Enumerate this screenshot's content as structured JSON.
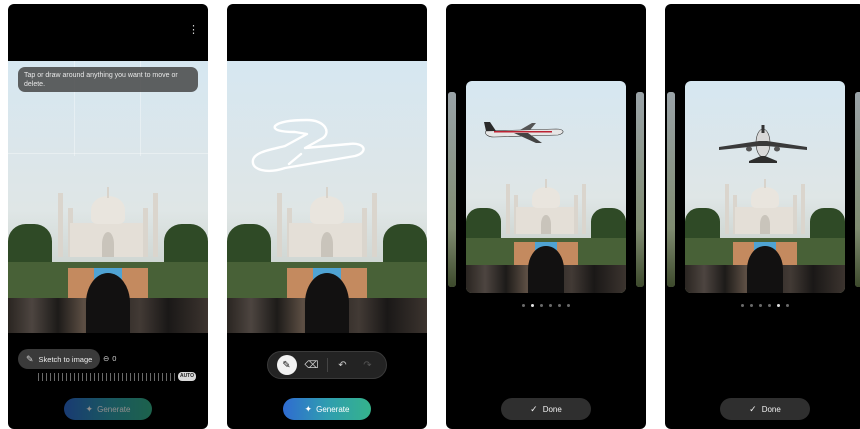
{
  "screen1": {
    "menu_icon": "more-vertical-icon",
    "hint_text": "Tap or draw around anything you want to move or delete.",
    "sketch_chip_label": "Sketch to image",
    "slider_value": "0",
    "auto_label": "AUTO",
    "generate_label": "Generate"
  },
  "screen2": {
    "tools": [
      {
        "name": "pen-tool",
        "icon": "pen-icon",
        "glyph": "✎"
      },
      {
        "name": "eraser-tool",
        "icon": "eraser-icon",
        "glyph": "⌫"
      },
      {
        "name": "undo-tool",
        "icon": "undo-icon",
        "glyph": "↶"
      },
      {
        "name": "redo-tool",
        "icon": "redo-icon",
        "glyph": "↷"
      }
    ],
    "generate_label": "Generate"
  },
  "screen3": {
    "page_indicator": {
      "count": 6,
      "active": 1
    },
    "done_label": "Done"
  },
  "screen4": {
    "page_indicator": {
      "count": 6,
      "active": 4
    },
    "done_label": "Done"
  },
  "colors": {
    "generate_gradient_start": "#2f6bd1",
    "generate_gradient_end": "#35b38b",
    "phone_bg": "#000000"
  }
}
